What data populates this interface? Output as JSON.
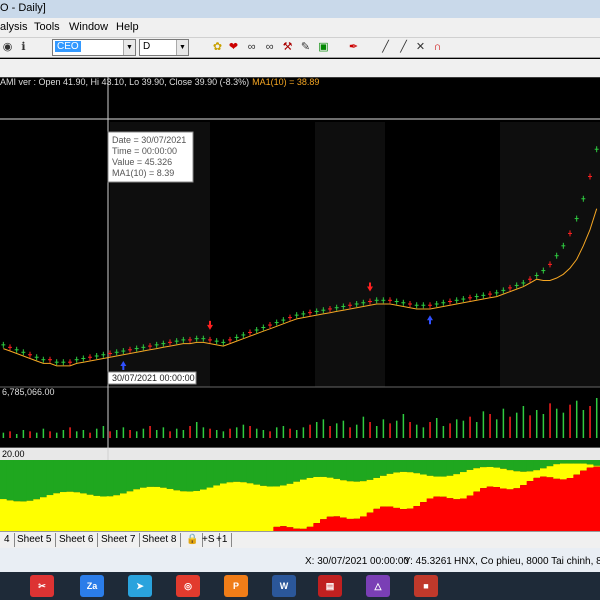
{
  "window": {
    "title": "O - Daily]"
  },
  "menu": [
    "alysis",
    "Tools",
    "Window",
    "Help"
  ],
  "toolbar": {
    "symbol": "CEO",
    "period": "D"
  },
  "chart_data": {
    "type": "line",
    "info_line": {
      "prefix": "AMI ver : Open 41.90, Hi 43.10, Lo 39.90, Close 39.90 (-8.3%)",
      "ma_label": "MA1(10) = 38.89"
    },
    "tooltip": [
      "Date = 30/07/2021",
      "Time = 00:00:00",
      "Value = 45.326",
      "MA1(10) = 8.39"
    ],
    "crosshair_date_label": "30/07/2021 00:00:00",
    "volume_label": "6,785,066.00",
    "indicator_label": "20.00",
    "price_series": [
      27,
      26.8,
      26.6,
      26.4,
      26.2,
      26.0,
      25.8,
      25.8,
      25.6,
      25.6,
      25.6,
      25.8,
      25.9,
      26.0,
      26.1,
      26.2,
      26.3,
      26.4,
      26.5,
      26.6,
      26.7,
      26.8,
      26.9,
      27.0,
      27.1,
      27.2,
      27.3,
      27.4,
      27.4,
      27.5,
      27.5,
      27.4,
      27.3,
      27.2,
      27.4,
      27.6,
      27.8,
      28.0,
      28.2,
      28.4,
      28.6,
      28.8,
      29.0,
      29.2,
      29.4,
      29.5,
      29.6,
      29.7,
      29.8,
      29.9,
      30.0,
      30.1,
      30.2,
      30.3,
      30.4,
      30.5,
      30.6,
      30.6,
      30.6,
      30.5,
      30.4,
      30.3,
      30.2,
      30.2,
      30.2,
      30.3,
      30.4,
      30.5,
      30.6,
      30.7,
      30.8,
      30.9,
      31.0,
      31.1,
      31.2,
      31.4,
      31.6,
      31.8,
      32.0,
      32.3,
      32.6,
      33.0,
      33.5,
      34.2,
      35.0,
      36.0,
      37.2,
      38.8,
      40.6,
      42.8
    ],
    "volume_series": [
      4,
      5,
      3,
      6,
      5,
      4,
      7,
      5,
      4,
      6,
      8,
      5,
      6,
      4,
      7,
      9,
      5,
      6,
      8,
      6,
      5,
      7,
      9,
      6,
      8,
      5,
      7,
      6,
      9,
      12,
      8,
      7,
      6,
      5,
      7,
      8,
      10,
      9,
      7,
      6,
      5,
      8,
      9,
      7,
      6,
      8,
      10,
      12,
      14,
      9,
      11,
      13,
      8,
      10,
      16,
      12,
      9,
      14,
      11,
      13,
      18,
      12,
      10,
      8,
      12,
      15,
      9,
      11,
      14,
      13,
      16,
      12,
      20,
      18,
      14,
      22,
      16,
      19,
      24,
      17,
      21,
      18,
      26,
      22,
      19,
      25,
      28,
      21,
      24,
      30
    ],
    "buy_signals": [
      18,
      64,
      109
    ],
    "sell_signals": [
      31,
      55,
      98
    ]
  },
  "sheets": [
    "4",
    "Sheet 5",
    "Sheet 6",
    "Sheet 7",
    "Sheet 8"
  ],
  "status": {
    "coords": "X: 30/07/2021 00:00:00",
    "y": "Y: 45.3261",
    "exchange": "HNX, Co phieu, 8000 Tai chinh, 8630"
  },
  "colors": {
    "bull": "#2ecc40",
    "bear": "#ff2020",
    "ma": "#f5a623",
    "indicator_green": "#1fa71f",
    "indicator_yellow": "#ffff00",
    "indicator_red": "#ff0000"
  }
}
